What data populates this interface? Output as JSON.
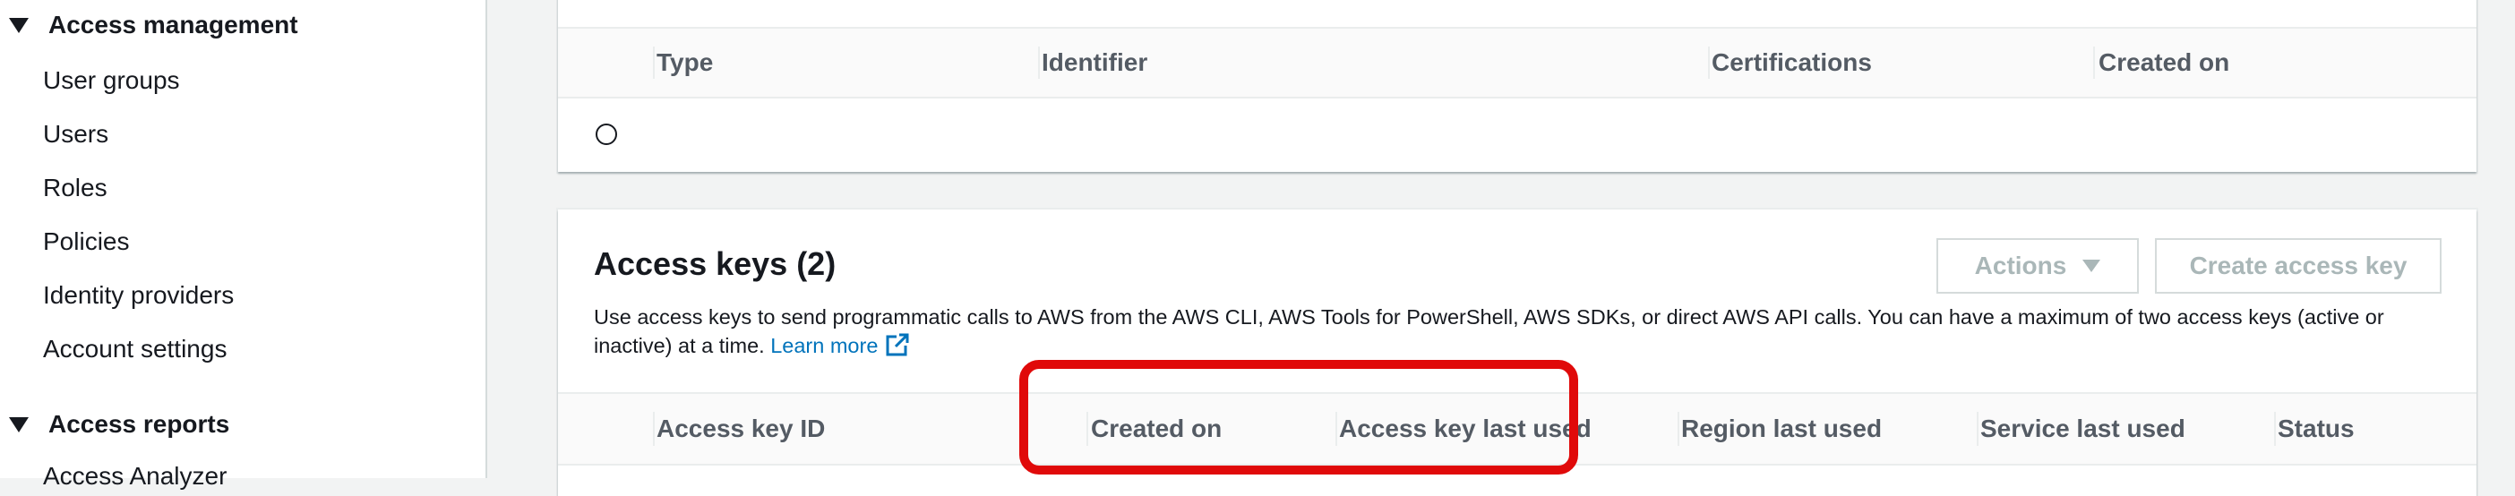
{
  "sidebar": {
    "access_management": "Access management",
    "items": [
      "User groups",
      "Users",
      "Roles",
      "Policies",
      "Identity providers",
      "Account settings"
    ],
    "access_reports": "Access reports",
    "partial_item": "Access Analyzer"
  },
  "top_table": {
    "headers": [
      "Type",
      "Identifier",
      "Certifications",
      "Created on"
    ]
  },
  "access_keys": {
    "title": "Access keys (2)",
    "description": "Use access keys to send programmatic calls to AWS from the AWS CLI, AWS Tools for PowerShell, AWS SDKs, or direct AWS API calls. You can have a maximum of two access keys (active or inactive) at a time.",
    "learn_more": "Learn more",
    "actions_label": "Actions",
    "create_label": "Create access key",
    "headers": [
      "Access key ID",
      "Created on",
      "Access key last used",
      "Region last used",
      "Service last used",
      "Status"
    ]
  },
  "colors": {
    "link": "#0073bb",
    "highlight": "#e00a0a",
    "disabled_text": "#aab7b8"
  }
}
